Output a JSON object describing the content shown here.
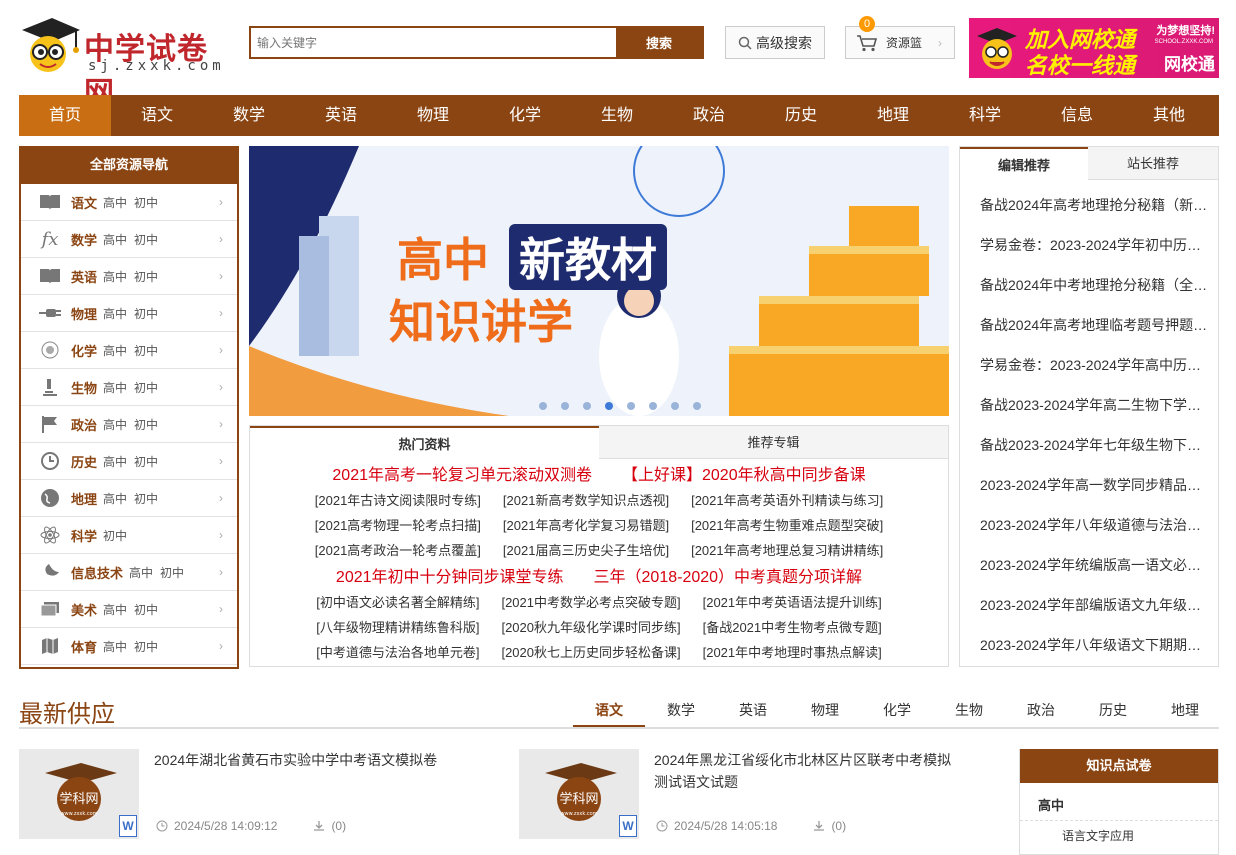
{
  "header": {
    "site_name": "中学试卷网",
    "domain": "sj.zxxk.com",
    "search_placeholder": "输入关键字",
    "search_button": "搜索",
    "advanced_search": "高级搜索",
    "cart_count": "0",
    "cart_label": "资源篮",
    "ad": {
      "line1": "加入网校通",
      "line2": "名校一线通",
      "slogan": "为梦想坚持!",
      "site": "SCHOOL.ZXXK.COM",
      "brand": "网校通"
    }
  },
  "nav": [
    "首页",
    "语文",
    "数学",
    "英语",
    "物理",
    "化学",
    "生物",
    "政治",
    "历史",
    "地理",
    "科学",
    "信息",
    "其他"
  ],
  "sidebar": {
    "title": "全部资源导航",
    "items": [
      {
        "subject": "语文",
        "levels": [
          "高中",
          "初中"
        ],
        "icon": "book-icon"
      },
      {
        "subject": "数学",
        "levels": [
          "高中",
          "初中"
        ],
        "icon": "function-icon"
      },
      {
        "subject": "英语",
        "levels": [
          "高中",
          "初中"
        ],
        "icon": "book-icon"
      },
      {
        "subject": "物理",
        "levels": [
          "高中",
          "初中"
        ],
        "icon": "plug-icon"
      },
      {
        "subject": "化学",
        "levels": [
          "高中",
          "初中"
        ],
        "icon": "flask-icon"
      },
      {
        "subject": "生物",
        "levels": [
          "高中",
          "初中"
        ],
        "icon": "microscope-icon"
      },
      {
        "subject": "政治",
        "levels": [
          "高中",
          "初中"
        ],
        "icon": "flag-icon"
      },
      {
        "subject": "历史",
        "levels": [
          "高中",
          "初中"
        ],
        "icon": "history-icon"
      },
      {
        "subject": "地理",
        "levels": [
          "高中",
          "初中"
        ],
        "icon": "globe-icon"
      },
      {
        "subject": "科学",
        "levels": [
          "初中"
        ],
        "icon": "atom-icon"
      },
      {
        "subject": "信息技术",
        "levels": [
          "高中",
          "初中"
        ],
        "icon": "satellite-icon"
      },
      {
        "subject": "美术",
        "levels": [
          "高中",
          "初中"
        ],
        "icon": "palette-icon"
      },
      {
        "subject": "体育",
        "levels": [
          "高中",
          "初中"
        ],
        "icon": "map-icon"
      }
    ]
  },
  "hero": {
    "title_a": "高中",
    "title_b": "新教材",
    "title_c": "知识讲学"
  },
  "hot": {
    "tabs": [
      "热门资料",
      "推荐专辑"
    ],
    "block1_big": [
      "2021年高考一轮复习单元滚动双测卷",
      "【上好课】2020年秋高中同步备课"
    ],
    "block1_links": [
      "[2021年古诗文阅读限时专练]",
      "[2021新高考数学知识点透视]",
      "[2021年高考英语外刊精读与练习]",
      "[2021高考物理一轮考点扫描]",
      "[2021年高考化学复习易错题]",
      "[2021年高考生物重难点题型突破]",
      "[2021高考政治一轮考点覆盖]",
      "[2021届高三历史尖子生培优]",
      "[2021年高考地理总复习精讲精练]"
    ],
    "block2_big": [
      "2021年初中十分钟同步课堂专练",
      "三年（2018-2020）中考真题分项详解"
    ],
    "block2_links": [
      "[初中语文必读名著全解精练]",
      "[2021中考数学必考点突破专题]",
      "[2021年中考英语语法提升训练]",
      "[八年级物理精讲精练鲁科版]",
      "[2020秋九年级化学课时同步练]",
      "[备战2021中考生物考点微专题]",
      "[中考道德与法治各地单元卷]",
      "[2020秋七上历史同步轻松备课]",
      "[2021年中考地理时事热点解读]"
    ]
  },
  "recommend": {
    "tabs": [
      "编辑推荐",
      "站长推荐"
    ],
    "items": [
      "备战2024年高考地理抢分秘籍（新…",
      "学易金卷：2023-2024学年初中历…",
      "备战2024年中考地理抢分秘籍（全…",
      "备战2024年高考地理临考题号押题…",
      "学易金卷：2023-2024学年高中历…",
      "备战2023-2024学年高二生物下学…",
      "备战2023-2024学年七年级生物下…",
      "2023-2024学年高一数学同步精品…",
      "2023-2024学年八年级道德与法治…",
      "2023-2024学年统编版高一语文必…",
      "2023-2024学年部编版语文九年级…",
      "2023-2024学年八年级语文下期期…"
    ]
  },
  "latest": {
    "title": "最新供应",
    "tabs": [
      "语文",
      "数学",
      "英语",
      "物理",
      "化学",
      "生物",
      "政治",
      "历史",
      "地理"
    ],
    "docs": [
      {
        "title": "2024年湖北省黄石市实验中学中考语文模拟卷",
        "time": "2024/5/28 14:09:12",
        "downloads": "(0)",
        "thumb_brand": "学科网",
        "thumb_site": "www.zxxk.com",
        "file_type": "W"
      },
      {
        "title": "2024年黑龙江省绥化市北林区片区联考中考模拟测试语文试题",
        "time": "2024/5/28 14:05:18",
        "downloads": "(0)",
        "thumb_brand": "学科网",
        "thumb_site": "www.zxxk.com",
        "file_type": "W"
      }
    ]
  },
  "knowledge": {
    "title": "知识点试卷",
    "level": "高中",
    "topic": "语言文字应用"
  }
}
